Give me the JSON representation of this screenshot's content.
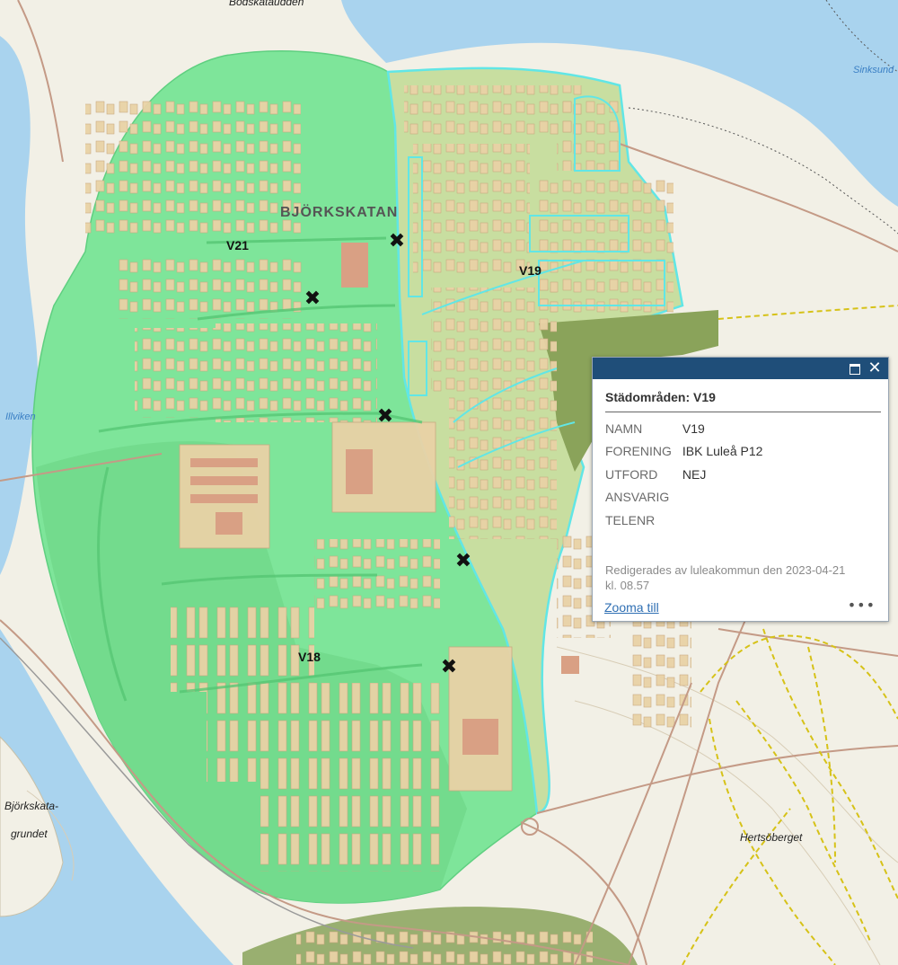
{
  "map": {
    "zone_labels": [
      "V21",
      "V19",
      "V18"
    ],
    "area_label": "BJÖRKSKATAN",
    "place_labels": [
      "Bodskataudden",
      "Hertsöberget",
      "Björkskata-",
      "grundet"
    ],
    "water_labels": [
      "Illviken",
      "Sinksund"
    ],
    "colors": {
      "water": "#a9d3ee",
      "land": "#f2f0e6",
      "zone_green": "#7ee59a",
      "zone_v19": "#c8dea0",
      "zone_v19_outline": "#61e6e6",
      "dark_green": "#8aa35a",
      "building": "#e9d2a6",
      "building_red": "#d9a084",
      "road": "#c49a86",
      "path": "#d6c218",
      "marker": "#111111"
    },
    "markers": [
      {
        "icon": "close-x-marker"
      },
      {
        "icon": "close-x-marker"
      },
      {
        "icon": "close-x-marker"
      },
      {
        "icon": "close-x-marker"
      },
      {
        "icon": "close-x-marker"
      }
    ]
  },
  "popup": {
    "title": "Städområden: V19",
    "fields": [
      {
        "name": "NAMN",
        "value": "V19"
      },
      {
        "name": "FORENING",
        "value": "IBK Luleå P12"
      },
      {
        "name": "UTFORD",
        "value": "NEJ"
      },
      {
        "name": "ANSVARIG",
        "value": ""
      },
      {
        "name": "TELENR",
        "value": ""
      }
    ],
    "edited_line1": "Redigerades av luleakommun den 2023-04-21",
    "edited_line2": "kl. 08.57",
    "zoom_link": "Zooma till",
    "more_symbol": "•••",
    "close_symbol": "✕",
    "header_color": "#1f4e79"
  }
}
